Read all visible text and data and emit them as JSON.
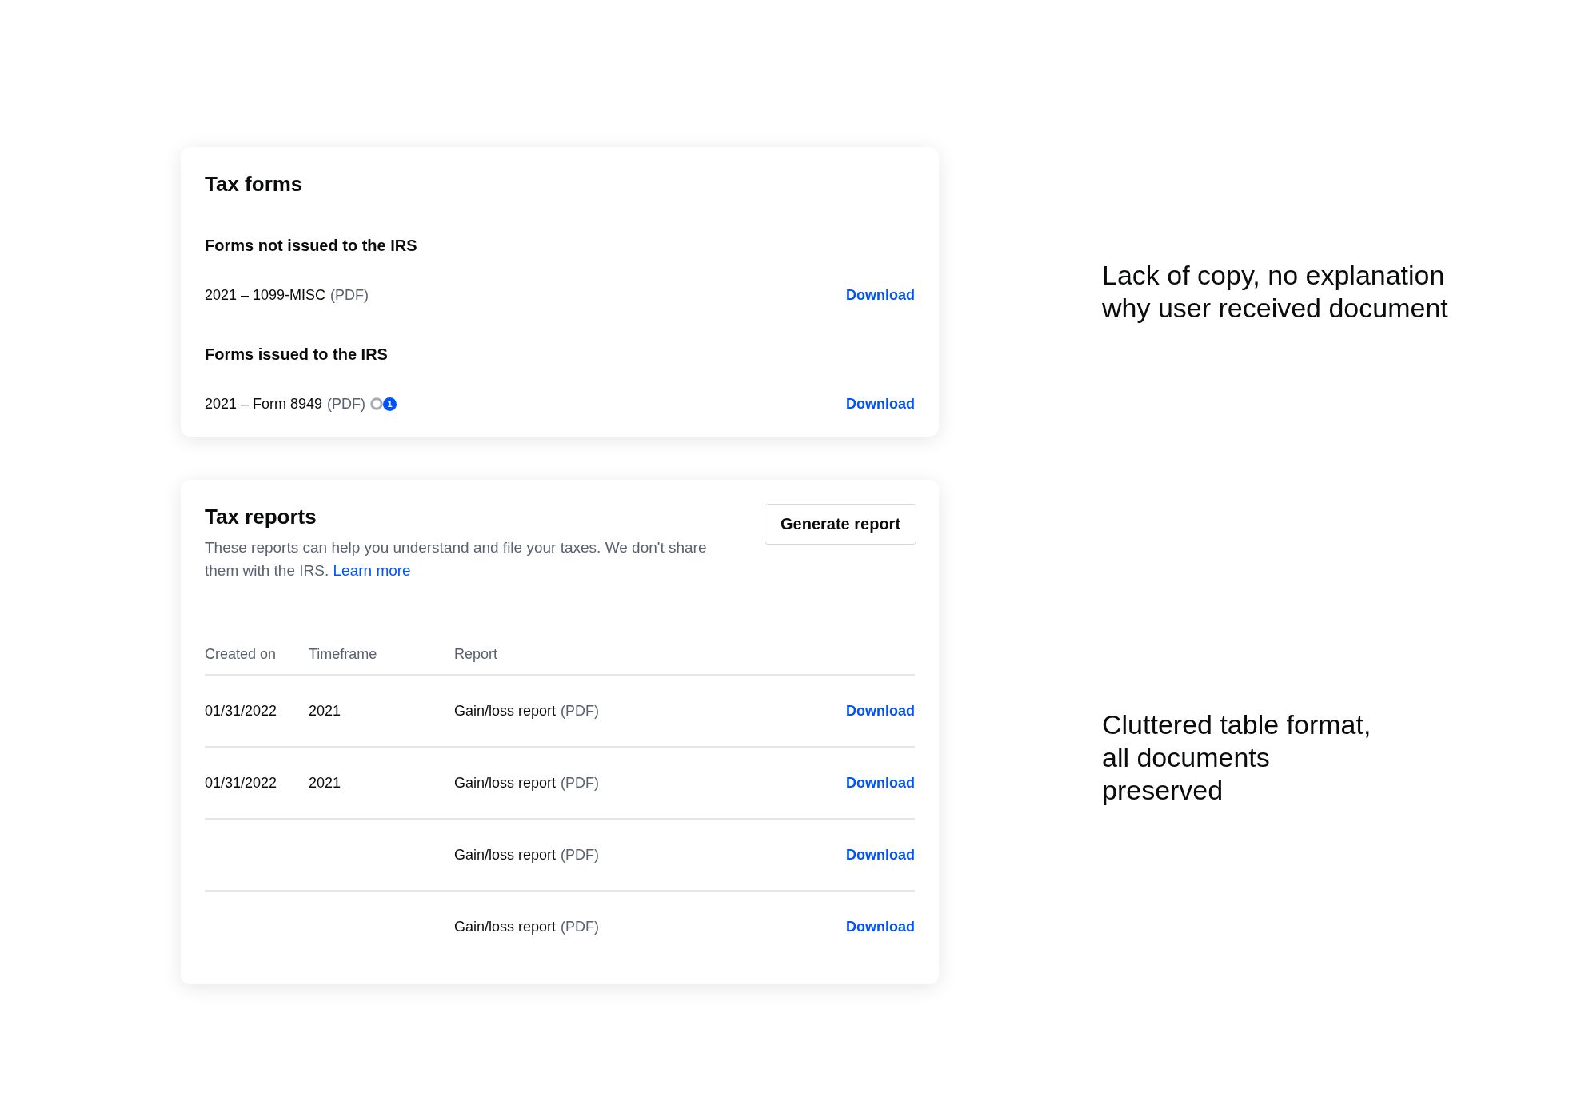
{
  "tax_forms": {
    "title": "Tax forms",
    "sections": [
      {
        "heading": "Forms not issued to the IRS",
        "items": [
          {
            "name": "2021 – 1099-MISC",
            "format": "(PDF)",
            "action": "Download"
          }
        ]
      },
      {
        "heading": "Forms issued to the IRS",
        "items": [
          {
            "name": "2021 – Form 8949",
            "format": "(PDF)",
            "badge": "1",
            "action": "Download"
          }
        ]
      }
    ]
  },
  "tax_reports": {
    "title": "Tax reports",
    "description": "These reports can help you understand and file your taxes. We don't share them with the IRS.",
    "link": "Learn more",
    "button": "Generate report",
    "columns": [
      "Created on",
      "Timeframe",
      "Report"
    ],
    "rows": [
      {
        "created_on": "01/31/2022",
        "timeframe": "2021",
        "report": "Gain/loss report",
        "format": "(PDF)",
        "action": "Download"
      },
      {
        "created_on": "01/31/2022",
        "timeframe": "2021",
        "report": "Gain/loss report",
        "format": "(PDF)",
        "action": "Download"
      },
      {
        "report": "Gain/loss report",
        "format": "(PDF)",
        "action": "Download"
      },
      {
        "report": "Gain/loss report",
        "format": "(PDF)",
        "action": "Download"
      }
    ]
  },
  "annotations": [
    "Lack of copy, no explanation why user received document",
    "Cluttered table format, all documents preserved"
  ]
}
